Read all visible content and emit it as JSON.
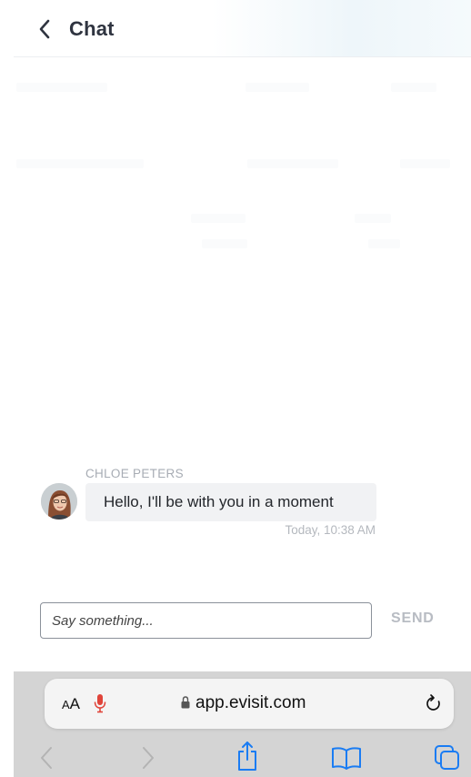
{
  "header": {
    "title": "Chat",
    "back_icon": "chevron-left-icon"
  },
  "message": {
    "sender": "CHLOE PETERS",
    "text": "Hello, I'll be with you in a moment",
    "timestamp": "Today, 10:38 AM",
    "avatar": "avatar-photo"
  },
  "composer": {
    "placeholder": "Say something...",
    "value": "",
    "send_label": "SEND"
  },
  "browser": {
    "text_size_label_small": "A",
    "text_size_label_large": "A",
    "url": "app.evisit.com",
    "icons": [
      "mic-icon",
      "lock-icon",
      "reload-icon"
    ],
    "toolbar": [
      "back-icon",
      "forward-icon",
      "share-icon",
      "bookmarks-icon",
      "tabs-icon"
    ]
  },
  "colors": {
    "title": "#2f3440",
    "bubble": "#f1f2f4",
    "muted_text": "#a7acb4",
    "send_disabled": "#b8bcc3",
    "toolbar_accent": "#1a7cf3",
    "mic_red": "#e0443a",
    "browser_bar": "#d4d4d4"
  }
}
